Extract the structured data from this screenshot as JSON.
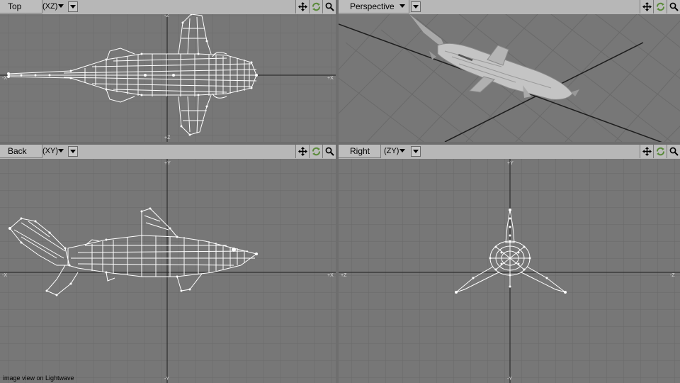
{
  "viewports": {
    "top": {
      "title": "Top",
      "axis": "(XZ)"
    },
    "perspective": {
      "title": "Perspective",
      "axis": ""
    },
    "back": {
      "title": "Back",
      "axis": "(XY)"
    },
    "right": {
      "title": "Right",
      "axis": "(ZY)"
    }
  },
  "tools": [
    "move-icon",
    "rotate-icon",
    "zoom-icon"
  ],
  "axis_labels": {
    "top": {
      "h_left": "-X",
      "h_right": "+X",
      "v_top": "-Z",
      "v_bottom": "+Z"
    },
    "back": {
      "h_left": "-X",
      "h_right": "+X",
      "v_top": "+Y",
      "v_bottom": "-Y"
    },
    "right": {
      "h_left": "+Z",
      "h_right": "-Z",
      "v_top": "+Y",
      "v_bottom": "-Y"
    }
  },
  "caption": "image view on Lightwave",
  "colors": {
    "viewport_bg": "#777777",
    "grid": "#6a6a6a",
    "axis": "#1e1e1e",
    "wire": "#ffffff",
    "titlebar": "#b7b7b7"
  }
}
